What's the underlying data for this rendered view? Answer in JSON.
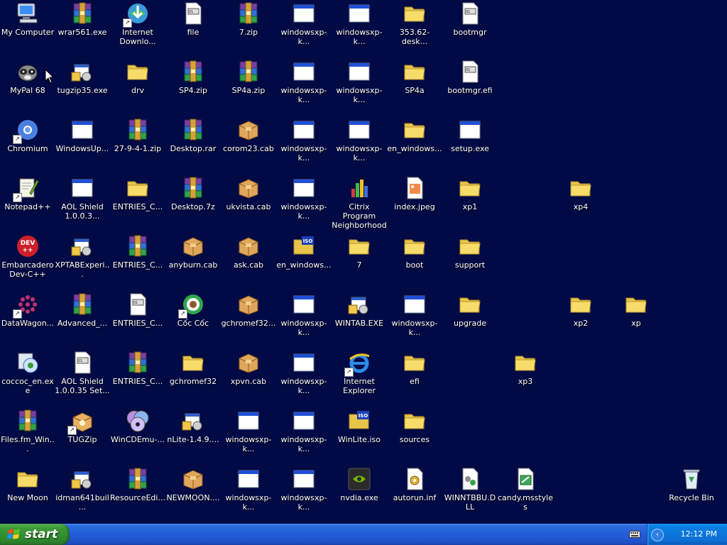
{
  "desktop": {
    "background": "#010a44",
    "icons": [
      {
        "label": "My Computer",
        "icon": "computer-icon",
        "col": 0,
        "row": 0,
        "shortcut": false
      },
      {
        "label": "MyPal 68",
        "icon": "raccoon-browser-icon",
        "col": 0,
        "row": 1,
        "shortcut": false
      },
      {
        "label": "Chromium",
        "icon": "chromium-icon",
        "col": 0,
        "row": 2,
        "shortcut": true
      },
      {
        "label": "Notepad++",
        "icon": "notepadpp-icon",
        "col": 0,
        "row": 3,
        "shortcut": true
      },
      {
        "label": "Embarcadero\nDev-C++",
        "icon": "devcpp-icon",
        "col": 0,
        "row": 4,
        "shortcut": false
      },
      {
        "label": "DataWagon...",
        "icon": "datawagon-icon",
        "col": 0,
        "row": 5,
        "shortcut": true
      },
      {
        "label": "coccoc_en.exe",
        "icon": "installer-icon",
        "col": 0,
        "row": 6,
        "shortcut": false
      },
      {
        "label": "Files.fm_Win...",
        "icon": "winrar-archive-icon",
        "col": 0,
        "row": 7,
        "shortcut": false
      },
      {
        "label": "New Moon",
        "icon": "folder-icon",
        "col": 0,
        "row": 8,
        "shortcut": false
      },
      {
        "label": "wrar561.exe",
        "icon": "winrar-archive-icon",
        "col": 1,
        "row": 0,
        "shortcut": false
      },
      {
        "label": "tugzip35.exe",
        "icon": "setup-icon",
        "col": 1,
        "row": 1,
        "shortcut": false
      },
      {
        "label": "WindowsUp...",
        "icon": "window-app-icon",
        "col": 1,
        "row": 2,
        "shortcut": false
      },
      {
        "label": "AOL Shield\n1.0.0.3...",
        "icon": "window-app-icon",
        "col": 1,
        "row": 3,
        "shortcut": false
      },
      {
        "label": "XPTABExperi...",
        "icon": "setup-icon",
        "col": 1,
        "row": 4,
        "shortcut": false
      },
      {
        "label": "Advanced_...",
        "icon": "winrar-archive-icon",
        "col": 1,
        "row": 5,
        "shortcut": false
      },
      {
        "label": "AOL Shield\n1.0.0.35 Set...",
        "icon": "document-icon",
        "col": 1,
        "row": 6,
        "shortcut": false
      },
      {
        "label": "TUGZip",
        "icon": "tugzip-icon",
        "col": 1,
        "row": 7,
        "shortcut": true
      },
      {
        "label": "idman641buil...",
        "icon": "setup-icon",
        "col": 1,
        "row": 8,
        "shortcut": false
      },
      {
        "label": "Internet\nDownlo...",
        "icon": "idm-icon",
        "col": 2,
        "row": 0,
        "shortcut": true
      },
      {
        "label": "drv",
        "icon": "folder-icon",
        "col": 2,
        "row": 1,
        "shortcut": false
      },
      {
        "label": "27-9-4-1.zip",
        "icon": "winrar-archive-icon",
        "col": 2,
        "row": 2,
        "shortcut": false
      },
      {
        "label": "ENTRIES_C...",
        "icon": "folder-icon",
        "col": 2,
        "row": 3,
        "shortcut": false
      },
      {
        "label": "ENTRIES_C...",
        "icon": "winrar-archive-icon",
        "col": 2,
        "row": 4,
        "shortcut": false
      },
      {
        "label": "ENTRIES_C...",
        "icon": "document-icon",
        "col": 2,
        "row": 5,
        "shortcut": false
      },
      {
        "label": "ENTRIES_C...",
        "icon": "winrar-archive-icon",
        "col": 2,
        "row": 6,
        "shortcut": false
      },
      {
        "label": "WinCDEmu-...",
        "icon": "cd-icon",
        "col": 2,
        "row": 7,
        "shortcut": false
      },
      {
        "label": "ResourceEdi...",
        "icon": "winrar-archive-icon",
        "col": 2,
        "row": 8,
        "shortcut": false
      },
      {
        "label": "file",
        "icon": "document-icon",
        "col": 3,
        "row": 0,
        "shortcut": false
      },
      {
        "label": "SP4.zip",
        "icon": "winrar-archive-icon",
        "col": 3,
        "row": 1,
        "shortcut": false
      },
      {
        "label": "Desktop.rar",
        "icon": "winrar-archive-icon",
        "col": 3,
        "row": 2,
        "shortcut": false
      },
      {
        "label": "Desktop.7z",
        "icon": "winrar-archive-icon",
        "col": 3,
        "row": 3,
        "shortcut": false
      },
      {
        "label": "anyburn.cab",
        "icon": "cab-icon",
        "col": 3,
        "row": 4,
        "shortcut": false
      },
      {
        "label": "Cốc Cốc",
        "icon": "coccoc-icon",
        "col": 3,
        "row": 5,
        "shortcut": true
      },
      {
        "label": "gchromef32",
        "icon": "folder-icon",
        "col": 3,
        "row": 6,
        "shortcut": false
      },
      {
        "label": "nLite-1.4.9....",
        "icon": "setup-icon",
        "col": 3,
        "row": 7,
        "shortcut": false
      },
      {
        "label": "NEWMOON....",
        "icon": "cab-icon",
        "col": 3,
        "row": 8,
        "shortcut": false
      },
      {
        "label": "7.zip",
        "icon": "winrar-archive-icon",
        "col": 4,
        "row": 0,
        "shortcut": false
      },
      {
        "label": "SP4a.zip",
        "icon": "winrar-archive-icon",
        "col": 4,
        "row": 1,
        "shortcut": false
      },
      {
        "label": "corom23.cab",
        "icon": "cab-icon",
        "col": 4,
        "row": 2,
        "shortcut": false
      },
      {
        "label": "ukvista.cab",
        "icon": "cab-icon",
        "col": 4,
        "row": 3,
        "shortcut": false
      },
      {
        "label": "ask.cab",
        "icon": "cab-icon",
        "col": 4,
        "row": 4,
        "shortcut": false
      },
      {
        "label": "gchromef32...",
        "icon": "cab-icon",
        "col": 4,
        "row": 5,
        "shortcut": false
      },
      {
        "label": "xpvn.cab",
        "icon": "cab-icon",
        "col": 4,
        "row": 6,
        "shortcut": false
      },
      {
        "label": "windowsxp-k...",
        "icon": "window-app-icon",
        "col": 4,
        "row": 7,
        "shortcut": false
      },
      {
        "label": "windowsxp-k...",
        "icon": "window-app-icon",
        "col": 4,
        "row": 8,
        "shortcut": false
      },
      {
        "label": "windowsxp-k...",
        "icon": "window-app-icon",
        "col": 5,
        "row": 0,
        "shortcut": false
      },
      {
        "label": "windowsxp-k...",
        "icon": "window-app-icon",
        "col": 5,
        "row": 1,
        "shortcut": false
      },
      {
        "label": "windowsxp-k...",
        "icon": "window-app-icon",
        "col": 5,
        "row": 2,
        "shortcut": false
      },
      {
        "label": "windowsxp-k...",
        "icon": "window-app-icon",
        "col": 5,
        "row": 3,
        "shortcut": false
      },
      {
        "label": "en_windows...",
        "icon": "iso-icon",
        "col": 5,
        "row": 4,
        "shortcut": false
      },
      {
        "label": "windowsxp-k...",
        "icon": "window-app-icon",
        "col": 5,
        "row": 5,
        "shortcut": false
      },
      {
        "label": "windowsxp-k...",
        "icon": "window-app-icon",
        "col": 5,
        "row": 6,
        "shortcut": false
      },
      {
        "label": "windowsxp-k...",
        "icon": "window-app-icon",
        "col": 5,
        "row": 7,
        "shortcut": false
      },
      {
        "label": "windowsxp-k...",
        "icon": "window-app-icon",
        "col": 5,
        "row": 8,
        "shortcut": false
      },
      {
        "label": "windowsxp-k...",
        "icon": "window-app-icon",
        "col": 6,
        "row": 0,
        "shortcut": false
      },
      {
        "label": "windowsxp-k...",
        "icon": "window-app-icon",
        "col": 6,
        "row": 1,
        "shortcut": false
      },
      {
        "label": "windowsxp-k...",
        "icon": "window-app-icon",
        "col": 6,
        "row": 2,
        "shortcut": false
      },
      {
        "label": "Citrix Program\nNeighborhood",
        "icon": "citrix-icon",
        "col": 6,
        "row": 3,
        "shortcut": false
      },
      {
        "label": "7",
        "icon": "folder-icon",
        "col": 6,
        "row": 4,
        "shortcut": false
      },
      {
        "label": "WINTAB.EXE",
        "icon": "setup-icon",
        "col": 6,
        "row": 5,
        "shortcut": false
      },
      {
        "label": "Internet\nExplorer",
        "icon": "internet-explorer-icon",
        "col": 6,
        "row": 6,
        "shortcut": true
      },
      {
        "label": "WinLite.iso",
        "icon": "iso-icon",
        "col": 6,
        "row": 7,
        "shortcut": false
      },
      {
        "label": "nvdia.exe",
        "icon": "nvidia-icon",
        "col": 6,
        "row": 8,
        "shortcut": false
      },
      {
        "label": "353.62-desk...",
        "icon": "folder-icon",
        "col": 7,
        "row": 0,
        "shortcut": false
      },
      {
        "label": "SP4a",
        "icon": "folder-icon",
        "col": 7,
        "row": 1,
        "shortcut": false
      },
      {
        "label": "en_windows...",
        "icon": "folder-icon",
        "col": 7,
        "row": 2,
        "shortcut": false
      },
      {
        "label": "index.jpeg",
        "icon": "image-file-icon",
        "col": 7,
        "row": 3,
        "shortcut": false
      },
      {
        "label": "boot",
        "icon": "folder-icon",
        "col": 7,
        "row": 4,
        "shortcut": false
      },
      {
        "label": "windowsxp-k...",
        "icon": "window-app-icon",
        "col": 7,
        "row": 5,
        "shortcut": false
      },
      {
        "label": "efi",
        "icon": "folder-icon",
        "col": 7,
        "row": 6,
        "shortcut": false
      },
      {
        "label": "sources",
        "icon": "folder-icon",
        "col": 7,
        "row": 7,
        "shortcut": false
      },
      {
        "label": "autorun.inf",
        "icon": "settings-file-icon",
        "col": 7,
        "row": 8,
        "shortcut": false
      },
      {
        "label": "bootmgr",
        "icon": "document-icon",
        "col": 8,
        "row": 0,
        "shortcut": false
      },
      {
        "label": "bootmgr.efi",
        "icon": "document-icon",
        "col": 8,
        "row": 1,
        "shortcut": false
      },
      {
        "label": "setup.exe",
        "icon": "window-app-icon",
        "col": 8,
        "row": 2,
        "shortcut": false
      },
      {
        "label": "xp1",
        "icon": "folder-icon",
        "col": 8,
        "row": 3,
        "shortcut": false
      },
      {
        "label": "support",
        "icon": "folder-icon",
        "col": 8,
        "row": 4,
        "shortcut": false
      },
      {
        "label": "upgrade",
        "icon": "folder-icon",
        "col": 8,
        "row": 5,
        "shortcut": false
      },
      {
        "label": "WINNTBBU.DLL",
        "icon": "dll-file-icon",
        "col": 8,
        "row": 8,
        "shortcut": false
      },
      {
        "label": "candy.msstyles",
        "icon": "msstyles-icon",
        "col": 9,
        "row": 8,
        "shortcut": false
      },
      {
        "label": "xp3",
        "icon": "folder-icon",
        "col": 9,
        "row": 6,
        "shortcut": false
      },
      {
        "label": "xp4",
        "icon": "folder-icon",
        "col": 10,
        "row": 3,
        "shortcut": false
      },
      {
        "label": "xp2",
        "icon": "folder-icon",
        "col": 10,
        "row": 5,
        "shortcut": false
      },
      {
        "label": "xp",
        "icon": "folder-icon",
        "col": 11,
        "row": 5,
        "shortcut": false
      },
      {
        "label": "Recycle Bin",
        "icon": "recycle-bin-icon",
        "col": 12,
        "row": 8,
        "shortcut": false
      }
    ]
  },
  "taskbar": {
    "start_label": "start",
    "clock": "12:12 PM",
    "chevron": "‹",
    "colors": {
      "taskbar": "#245edb",
      "start": "#3c9a37",
      "tray": "#0e6ed3"
    }
  }
}
